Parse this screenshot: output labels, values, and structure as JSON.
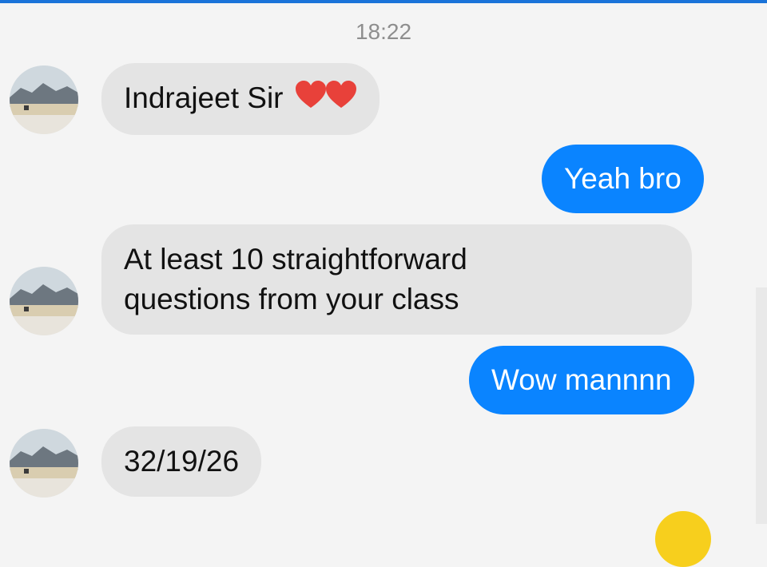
{
  "timestamp": "18:22",
  "messages": [
    {
      "side": "incoming",
      "text": "Indrajeet Sir",
      "emoji": [
        "red-heart",
        "red-heart"
      ]
    },
    {
      "side": "outgoing",
      "text": "Yeah bro"
    },
    {
      "side": "incoming",
      "lines": [
        "At least 10 straightforward",
        "questions from your class"
      ]
    },
    {
      "side": "outgoing",
      "text": "Wow mannnn"
    },
    {
      "side": "incoming",
      "text": "32/19/26"
    }
  ],
  "colors": {
    "outgoing_bubble": "#0a84ff",
    "incoming_bubble": "#e4e4e4",
    "top_bar": "#1a73d9",
    "timestamp": "#8e8e8e"
  }
}
